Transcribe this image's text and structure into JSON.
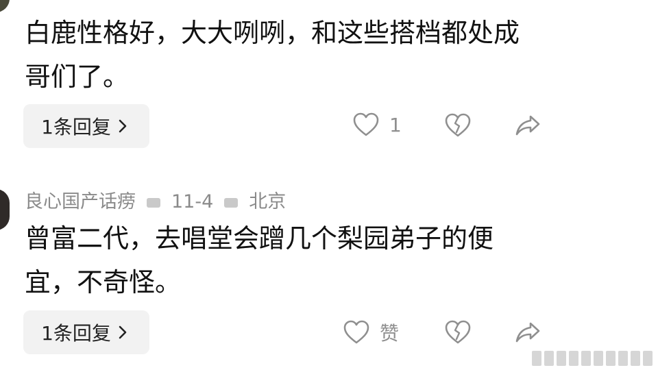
{
  "comments": [
    {
      "author_name": "",
      "text": "白鹿性格好，大大咧咧，和这些搭档都处成哥们了。",
      "reply_label": "1条回复",
      "like_count": "1"
    },
    {
      "author_name": "良心国产话痨",
      "date": "11-4",
      "location": "北京",
      "text": "曾富二代，去唱堂会蹭几个梨园弟子的便宜，不奇怪。",
      "reply_label": "1条回复",
      "like_label": "赞"
    }
  ],
  "icons": {
    "like": "heart-outline-icon",
    "dislike": "broken-heart-icon",
    "share": "share-arrow-icon",
    "chevron": "chevron-right-icon"
  },
  "colors": {
    "text": "#111111",
    "meta": "#8a8a8a",
    "icon": "#8f8f8f",
    "button_bg": "#f2f2f2"
  }
}
